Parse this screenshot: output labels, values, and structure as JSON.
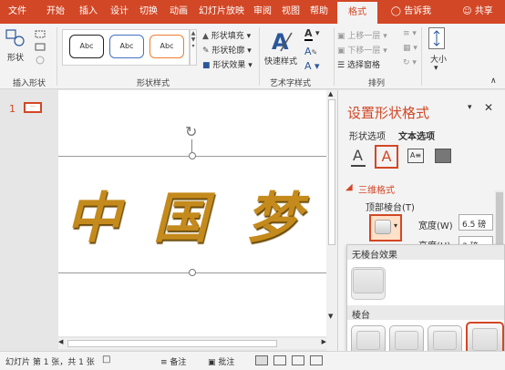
{
  "tabs": [
    "文件",
    "开始",
    "插入",
    "设计",
    "切换",
    "动画",
    "幻灯片放映",
    "审阅",
    "视图",
    "帮助",
    "格式"
  ],
  "tell_me": "告诉我",
  "share": "共享",
  "ribbon": {
    "insert_shapes": {
      "shape_label": "形状",
      "group": "插入形状"
    },
    "shape_styles": {
      "samples": [
        "Abc",
        "Abc",
        "Abc"
      ],
      "fill": "形状填充",
      "outline": "形状轮廓",
      "effects": "形状效果",
      "group": "形状样式"
    },
    "wordart": {
      "quick": "快速样式",
      "group": "艺术字样式"
    },
    "arrange": {
      "bring_forward": "上移一层",
      "send_backward": "下移一层",
      "selection_pane": "选择窗格",
      "group": "排列"
    },
    "size": {
      "label": "大小"
    }
  },
  "thumbnail": {
    "number": "1"
  },
  "slide_text": [
    "中",
    "国",
    "梦"
  ],
  "pane": {
    "title": "设置形状格式",
    "tab_shape": "形状选项",
    "tab_text": "文本选项",
    "section": "三维格式",
    "top_bevel": "顶部棱台(T)",
    "width_label": "宽度(W)",
    "width_value": "6.5 磅",
    "height_label": "高度(H)",
    "height_value": "3 磅"
  },
  "dropdown": {
    "no_bevel": "无棱台效果",
    "bevel": "棱台"
  },
  "status": {
    "slide_info": "幻灯片 第 1 张，共 1 张",
    "notes": "备注",
    "comments": "批注"
  },
  "colors": {
    "accent": "#d24726",
    "gold": "#c48a1c"
  }
}
